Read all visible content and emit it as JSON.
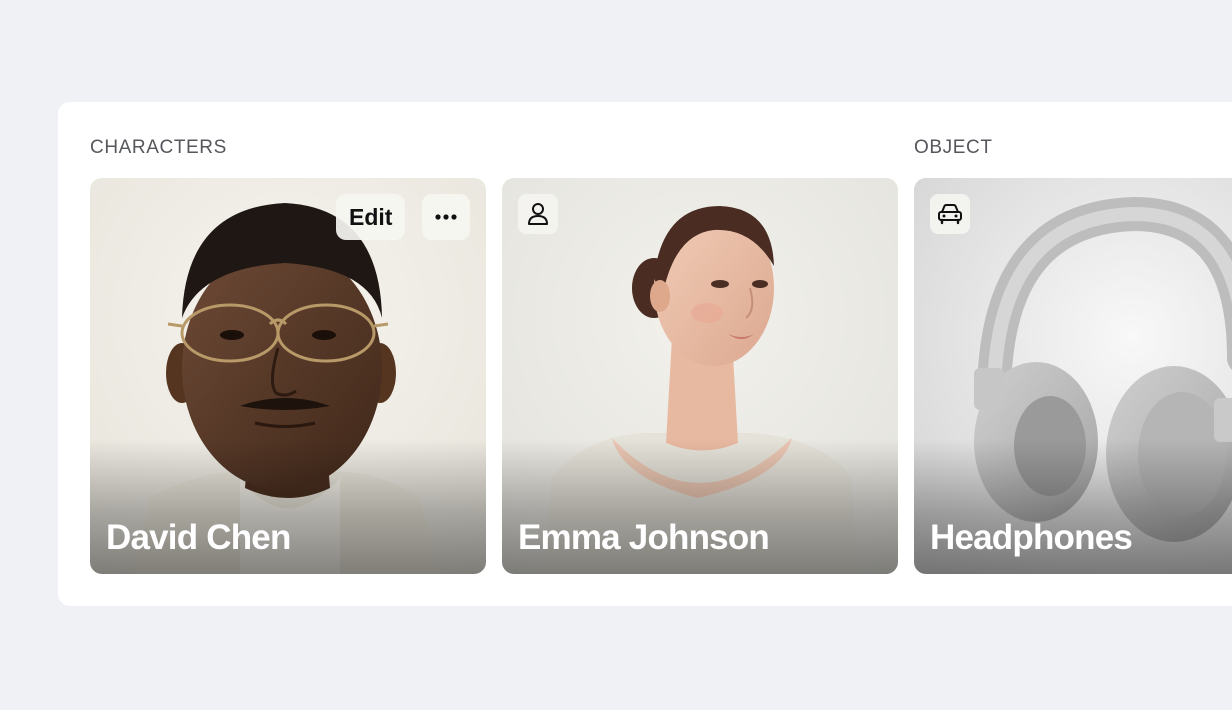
{
  "sections": [
    {
      "label": "CHARACTERS"
    },
    {
      "label": "OBJECT"
    }
  ],
  "cards": [
    {
      "title": "David Chen",
      "image": "portrait of a man with glasses",
      "actions": {
        "edit_label": "Edit",
        "more_icon": "more-horizontal-icon"
      }
    },
    {
      "title": "Emma Johnson",
      "image": "portrait of a woman with hair bun",
      "type_icon": "person-icon"
    },
    {
      "title": "Headphones",
      "image": "grey over-ear headphones",
      "type_icon": "car-icon"
    }
  ],
  "colors": {
    "page_bg": "#f0f1f5",
    "panel_bg": "#ffffff",
    "section_label": "#55575d",
    "card_title": "#ffffff"
  }
}
